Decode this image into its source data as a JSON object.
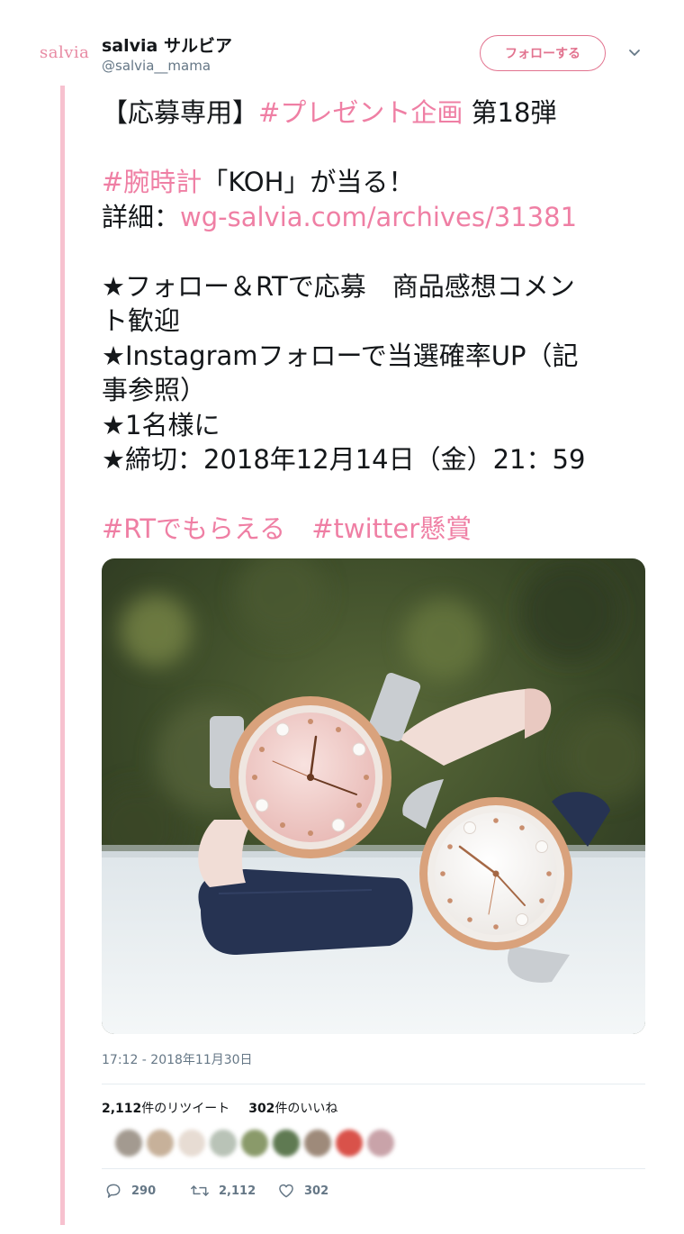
{
  "account": {
    "logo_text": "salvia",
    "display_name": "salvia サルビア",
    "handle": "@salvia__mama"
  },
  "follow_button": {
    "label": "フォローする"
  },
  "tweet": {
    "line1_a": "【応募専用】",
    "line1_tag": "#プレゼント企画",
    "line1_b": " 第18弾",
    "line2_tag": "#腕時計",
    "line2_b": "「KOH」が当る！",
    "line3_a": "詳細：",
    "line3_link": "wg-salvia.com/archives/31381",
    "line4": "★フォロー＆RTで応募　商品感想コメン",
    "line5": "ト歓迎",
    "line6": "★Instagramフォローで当選確率UP（記",
    "line7": "事参照）",
    "line8": "★1名様に",
    "line9": "★締切：2018年12月14日（金）21：59",
    "tag_a": "#RTでもらえる",
    "tag_b": "#twitter懸賞"
  },
  "photo": {
    "subject": "two-wristwatches"
  },
  "timestamp": "17:12 - 2018年11月30日",
  "stats": {
    "retweets_count": "2,112",
    "retweets_label": "件のリツイート",
    "likes_count": "302",
    "likes_label": "件のいいね"
  },
  "actions": {
    "replies": "290",
    "retweets": "2,112",
    "likes": "302"
  },
  "colors": {
    "accent": "#ef7fa4",
    "follow": "#e2738f",
    "side_line": "#f7c1cf",
    "muted": "#657786"
  },
  "icons": [
    "chevron-down-icon",
    "reply-icon",
    "retweet-icon",
    "heart-icon"
  ]
}
